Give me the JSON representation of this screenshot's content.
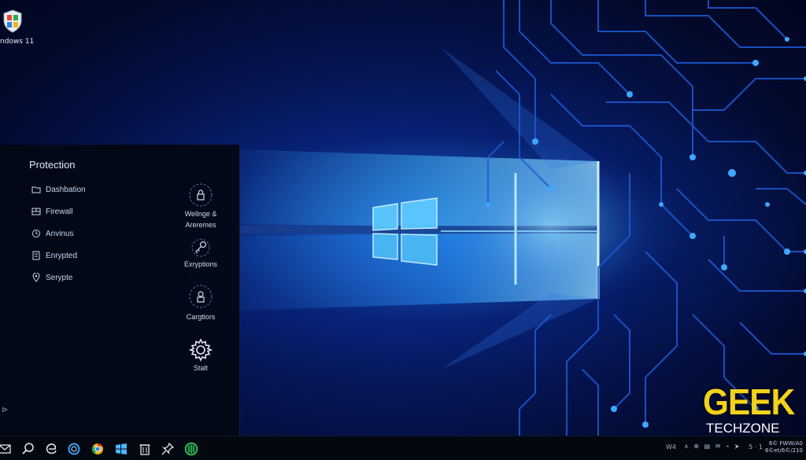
{
  "desktop": {
    "app_label": "ndows 11"
  },
  "panel": {
    "title": "Protection",
    "items": [
      {
        "label": "Dashbation",
        "icon": "shield-icon"
      },
      {
        "label": "Firewall",
        "icon": "firewall-icon"
      },
      {
        "label": "Anvinus",
        "icon": "antivirus-icon"
      },
      {
        "label": "Enrypted",
        "icon": "document-icon"
      },
      {
        "label": "Serypte",
        "icon": "location-pin-icon"
      }
    ],
    "side_actions": [
      {
        "label_line1": "Wellnge &",
        "label_line2": "Areremes",
        "icon": "lock-icon"
      },
      {
        "label_line1": "Exryptions",
        "label_line2": "",
        "icon": "key-icon"
      },
      {
        "label_line1": "Cargtiors",
        "label_line2": "",
        "icon": "padlock-icon"
      },
      {
        "label_line1": "Stalt",
        "label_line2": "",
        "icon": "gear-icon"
      }
    ],
    "footer_glyph": "⊳"
  },
  "taskbar": {
    "icons": [
      "mail-icon",
      "search-icon",
      "edge-icon",
      "cortana-icon",
      "chrome-icon",
      "windows-icon",
      "trash-icon",
      "pin-icon",
      "defender-icon"
    ],
    "tray_text_left": "W4",
    "tray_glyphs": "∧ ⊕ ▤ ✉ ⌁ ⮞",
    "tray_numbers": "5 · 1",
    "clock_line1": "6© FWW/A0",
    "clock_line2": "6©et/6©/210"
  },
  "watermark": {
    "line1": "GEEK",
    "line2": "TECHZONE",
    "color": "#f2d21a"
  },
  "colors": {
    "accent": "#3fa7ff",
    "panel_bg": "#030816",
    "circuit": "#1e5bd6"
  }
}
